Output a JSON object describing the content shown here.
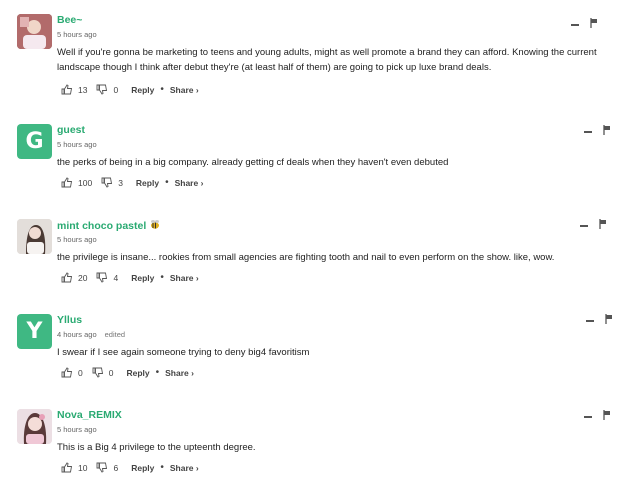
{
  "comments": [
    {
      "username": "Bee~",
      "timestamp": "5 hours ago",
      "edited": "",
      "avatar": {
        "type": "photo",
        "icon": "user-photo-icon",
        "bg": "#7a4a4a"
      },
      "text": "Well if you're gonna be marketing to teens and young adults, might as well promote a brand they can afford. Knowing the current landscape though I think after debut they're (at least half of them) are going to pick up luxe brand deals.",
      "likes": "13",
      "dislikes": "0",
      "reply_label": "Reply",
      "share_label": "Share ›"
    },
    {
      "username": "guest",
      "timestamp": "5 hours ago",
      "edited": "",
      "avatar": {
        "type": "letter",
        "letter": "G"
      },
      "text": "the perks of being in a big company. already getting cf deals when they haven't even debuted",
      "likes": "100",
      "dislikes": "3",
      "reply_label": "Reply",
      "share_label": "Share ›"
    },
    {
      "username": "mint choco pastel",
      "timestamp": "5 hours ago",
      "edited": "",
      "avatar": {
        "type": "photo",
        "icon": "user-photo-icon",
        "bg": "#d8d2cd"
      },
      "text": "the privilege is insane... rookies from small agencies are fighting tooth and nail to even perform on the show. like, wow.",
      "likes": "20",
      "dislikes": "4",
      "reply_label": "Reply",
      "share_label": "Share ›"
    },
    {
      "username": "Yllus",
      "timestamp": "4 hours ago",
      "edited": "edited",
      "avatar": {
        "type": "letter",
        "letter": "Y"
      },
      "text": "I swear if I see again someone trying to deny big4 favoritism",
      "likes": "0",
      "dislikes": "0",
      "reply_label": "Reply",
      "share_label": "Share ›"
    },
    {
      "username": "Nova_REMIX",
      "timestamp": "5 hours ago",
      "edited": "",
      "avatar": {
        "type": "photo",
        "icon": "user-photo-icon",
        "bg": "#e6dcdc"
      },
      "text": "This is a Big 4 privilege to the upteenth degree.",
      "likes": "10",
      "dislikes": "6",
      "reply_label": "Reply",
      "share_label": "Share ›"
    }
  ],
  "colors": {
    "username": "#2aaa72",
    "avatar_letter_bg": "#3fb883"
  }
}
